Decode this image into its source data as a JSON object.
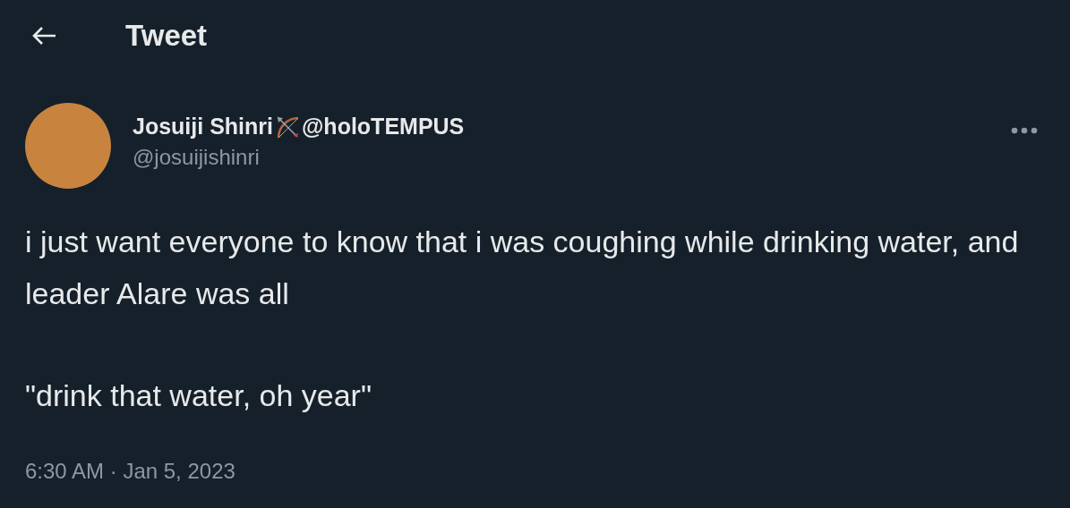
{
  "header": {
    "title": "Tweet"
  },
  "author": {
    "name": "Josuiji Shinri",
    "name_suffix": "@holoTEMPUS",
    "handle": "@josuijishinri"
  },
  "tweet": {
    "paragraphs": [
      "i just want everyone to know that i was coughing while drinking water, and leader Alare was all",
      "\"drink that water, oh year\""
    ],
    "timestamp": "6:30 AM · Jan 5, 2023"
  }
}
